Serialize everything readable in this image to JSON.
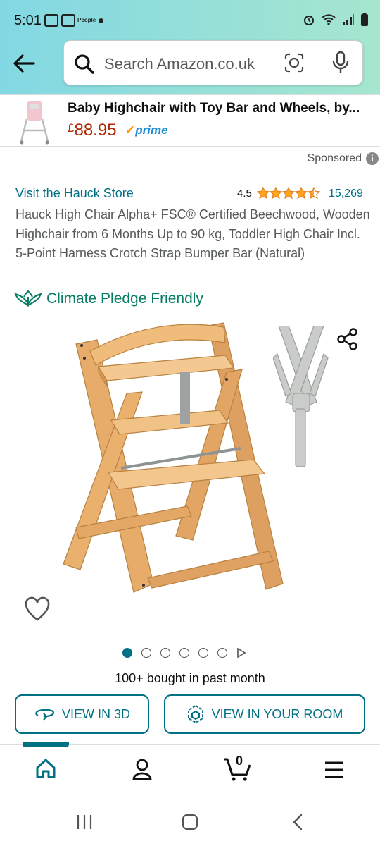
{
  "status_bar": {
    "time": "5:01",
    "notif_label": "People"
  },
  "search": {
    "placeholder": "Search Amazon.co.uk"
  },
  "sponsored_banner": {
    "title": "Baby Highchair with Toy Bar and Wheels, by...",
    "price_currency": "£",
    "price": "88.95",
    "prime_label": "prime"
  },
  "sponsored_label": "Sponsored",
  "product": {
    "store_link": "Visit the Hauck Store",
    "rating": "4.5",
    "rating_value": 4.5,
    "rating_count": "15,269",
    "title": "Hauck High Chair Alpha+ FSC® Certified Beechwood, Wooden Highchair from 6 Months Up to 90 kg, Toddler High Chair Incl. 5-Point Harness Crotch Strap Bumper Bar (Natural)",
    "climate_label": "Climate Pledge Friendly",
    "image_count": 6,
    "active_image": 1,
    "bought_text": "100+ bought in past month"
  },
  "buttons": {
    "view_3d": "VIEW IN 3D",
    "view_room": "VIEW IN YOUR ROOM"
  },
  "tabbar": {
    "cart_count": "0",
    "active_tab": "home"
  },
  "colors": {
    "link": "#007185",
    "price": "#B12704",
    "climate": "#067D62",
    "star": "#FFA41C",
    "header_start": "#82d8e3",
    "header_end": "#a6e6ce"
  }
}
